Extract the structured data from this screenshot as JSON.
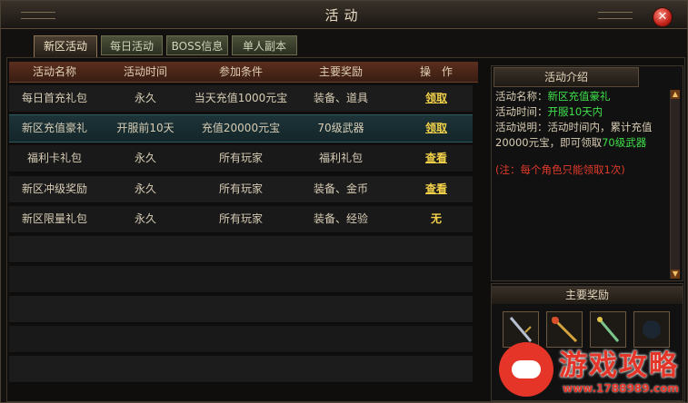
{
  "window": {
    "title": "活动",
    "close_label": "✕"
  },
  "tabs": [
    {
      "label": "新区活动",
      "active": true
    },
    {
      "label": "每日活动",
      "active": false
    },
    {
      "label": "BOSS信息",
      "active": false
    },
    {
      "label": "单人副本",
      "active": false
    }
  ],
  "table": {
    "columns": [
      "活动名称",
      "活动时间",
      "参加条件",
      "主要奖励",
      "操　作"
    ],
    "rows": [
      {
        "name": "每日首充礼包",
        "time": "永久",
        "cond": "当天充值1000元宝",
        "reward": "装备、道具",
        "action": "领取"
      },
      {
        "name": "新区充值豪礼",
        "time": "开服前10天",
        "cond": "充值20000元宝",
        "reward": "70级武器",
        "action": "领取"
      },
      {
        "name": "福利卡礼包",
        "time": "永久",
        "cond": "所有玩家",
        "reward": "福利礼包",
        "action": "查看"
      },
      {
        "name": "新区冲级奖励",
        "time": "永久",
        "cond": "所有玩家",
        "reward": "装备、金币",
        "action": "查看"
      },
      {
        "name": "新区限量礼包",
        "time": "永久",
        "cond": "所有玩家",
        "reward": "装备、经验",
        "action": "无"
      }
    ]
  },
  "intro": {
    "header": "活动介绍",
    "name_label": "活动名称：",
    "name_value": "新区充值豪礼",
    "time_label": "活动时间：",
    "time_value": "开服10天内",
    "desc_label": "活动说明：",
    "desc_text1": "活动时间内，累计充值",
    "desc_text2": "20000元宝，即可领取",
    "desc_highlight": "70级武器",
    "note": "(注：每个角色只能领取1次)"
  },
  "rewards": {
    "header": "主要奖励"
  },
  "watermark": {
    "brand": "游戏攻略",
    "site": "www.1788989.com"
  },
  "colors": {
    "highlight": "#3fe04a",
    "note": "#e03a2a",
    "action": "#f3d24a"
  }
}
